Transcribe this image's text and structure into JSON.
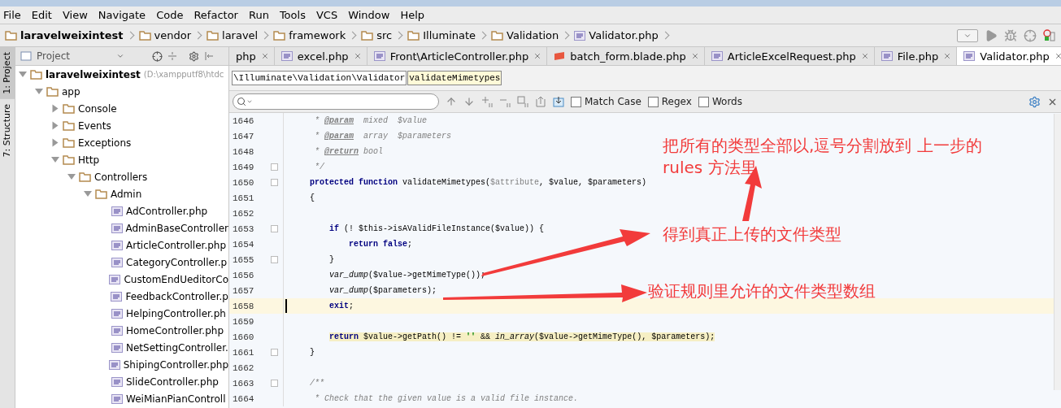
{
  "menu": [
    "File",
    "Edit",
    "View",
    "Navigate",
    "Code",
    "Refactor",
    "Run",
    "Tools",
    "VCS",
    "Window",
    "Help"
  ],
  "breadcrumb": [
    {
      "label": "laravelweixintest",
      "kind": "root"
    },
    {
      "label": "vendor",
      "kind": "folder"
    },
    {
      "label": "laravel",
      "kind": "folder"
    },
    {
      "label": "framework",
      "kind": "folder"
    },
    {
      "label": "src",
      "kind": "folder"
    },
    {
      "label": "Illuminate",
      "kind": "folder"
    },
    {
      "label": "Validation",
      "kind": "folder"
    },
    {
      "label": "Validator.php",
      "kind": "php"
    }
  ],
  "side_tabs": [
    {
      "label": "1: Project",
      "selected": true
    },
    {
      "label": "7: Structure",
      "selected": false
    }
  ],
  "project_panel": {
    "title": "Project",
    "tree": {
      "label": "laravelweixintest",
      "path": "(D:\\xampputf8\\htdc",
      "expanded": true,
      "children": [
        {
          "label": "app",
          "expanded": true,
          "children": [
            {
              "label": "Console",
              "expanded": false
            },
            {
              "label": "Events",
              "expanded": false
            },
            {
              "label": "Exceptions",
              "expanded": false
            },
            {
              "label": "Http",
              "expanded": true,
              "children": [
                {
                  "label": "Controllers",
                  "expanded": true,
                  "children": [
                    {
                      "label": "Admin",
                      "expanded": true,
                      "children": [
                        {
                          "label": "AdController.php",
                          "kind": "php"
                        },
                        {
                          "label": "AdminBaseController",
                          "kind": "php"
                        },
                        {
                          "label": "ArticleController.php",
                          "kind": "php"
                        },
                        {
                          "label": "CategoryController.p",
                          "kind": "php"
                        },
                        {
                          "label": "CustomEndUeditorCo",
                          "kind": "php"
                        },
                        {
                          "label": "FeedbackController.p",
                          "kind": "php"
                        },
                        {
                          "label": "HelpingController.ph",
                          "kind": "php"
                        },
                        {
                          "label": "HomeController.php",
                          "kind": "php"
                        },
                        {
                          "label": "NetSettingController.",
                          "kind": "php"
                        },
                        {
                          "label": "ShipingController.php",
                          "kind": "php"
                        },
                        {
                          "label": "SlideController.php",
                          "kind": "php"
                        },
                        {
                          "label": "WeiMianPianControll",
                          "kind": "php"
                        }
                      ]
                    }
                  ]
                }
              ]
            }
          ]
        }
      ]
    }
  },
  "tabs": [
    {
      "label": "php",
      "selected": false
    },
    {
      "label": "excel.php",
      "kind": "php",
      "selected": false
    },
    {
      "label": "Front\\ArticleController.php",
      "kind": "php",
      "selected": false
    },
    {
      "label": "batch_form.blade.php",
      "kind": "blade",
      "selected": false
    },
    {
      "label": "ArticleExcelRequest.php",
      "kind": "php",
      "selected": false
    },
    {
      "label": "File.php",
      "kind": "php",
      "selected": false
    },
    {
      "label": "Validator.php",
      "kind": "php",
      "selected": true
    }
  ],
  "editor_path": [
    {
      "label": "\\Illuminate\\Validation\\Validator",
      "selected": false
    },
    {
      "label": "validateMimetypes",
      "selected": true
    }
  ],
  "find_bar": {
    "options": [
      {
        "label": "Match Case",
        "checked": false
      },
      {
        "label": "Regex",
        "checked": false
      },
      {
        "label": "Words",
        "checked": false
      }
    ]
  },
  "code": [
    {
      "number": "1646",
      "fold": false,
      "current": false,
      "tokens": [
        {
          "kind": "comment",
          "text": "     * "
        },
        {
          "kind": "doctag",
          "text": "@param"
        },
        {
          "kind": "comment",
          "text": "  mixed  $value"
        }
      ]
    },
    {
      "number": "1647",
      "fold": false,
      "current": false,
      "tokens": [
        {
          "kind": "comment",
          "text": "     * "
        },
        {
          "kind": "doctag",
          "text": "@param"
        },
        {
          "kind": "comment",
          "text": "  array  $parameters"
        }
      ]
    },
    {
      "number": "1648",
      "fold": false,
      "current": false,
      "tokens": [
        {
          "kind": "comment",
          "text": "     * "
        },
        {
          "kind": "doctag",
          "text": "@return"
        },
        {
          "kind": "comment",
          "text": " bool"
        }
      ]
    },
    {
      "number": "1649",
      "fold": true,
      "current": false,
      "tokens": [
        {
          "kind": "comment",
          "text": "     */"
        }
      ]
    },
    {
      "number": "1650",
      "fold": true,
      "current": false,
      "tokens": [
        {
          "kind": "keyword",
          "text": "    protected function"
        },
        {
          "kind": "plain",
          "text": " validateMimetypes("
        },
        {
          "kind": "param",
          "text": "$attribute"
        },
        {
          "kind": "plain",
          "text": ", $value, $parameters)"
        }
      ]
    },
    {
      "number": "1651",
      "fold": false,
      "current": false,
      "tokens": [
        {
          "kind": "plain",
          "text": "    {"
        }
      ]
    },
    {
      "number": "1652",
      "fold": false,
      "current": false
    },
    {
      "number": "1653",
      "fold": true,
      "current": false,
      "tokens": [
        {
          "kind": "keyword",
          "text": "        if"
        },
        {
          "kind": "plain",
          "text": " (! $this->isAValidFileInstance($value)) {"
        }
      ]
    },
    {
      "number": "1654",
      "fold": false,
      "current": false,
      "tokens": [
        {
          "kind": "keyword",
          "text": "            return false"
        },
        {
          "kind": "plain",
          "text": ";"
        }
      ]
    },
    {
      "number": "1655",
      "fold": true,
      "current": false,
      "tokens": [
        {
          "kind": "plain",
          "text": "        }"
        }
      ]
    },
    {
      "number": "1656",
      "fold": false,
      "current": false,
      "tokens": [
        {
          "kind": "fn",
          "text": "        var_dump"
        },
        {
          "kind": "plain",
          "text": "($value->getMimeType());"
        }
      ]
    },
    {
      "number": "1657",
      "fold": false,
      "current": false,
      "tokens": [
        {
          "kind": "fn",
          "text": "        var_dump"
        },
        {
          "kind": "plain",
          "text": "($parameters);"
        }
      ]
    },
    {
      "number": "1658",
      "fold": false,
      "current": true,
      "tokens": [
        {
          "kind": "keyword",
          "text": "        exit"
        },
        {
          "kind": "plain",
          "text": ";"
        }
      ]
    },
    {
      "number": "1659",
      "fold": false,
      "current": false
    },
    {
      "number": "1660",
      "fold": false,
      "current": false,
      "marked": true,
      "tokens": [
        {
          "kind": "keyword",
          "text": "        return"
        },
        {
          "kind": "plain",
          "text": " $value->getPath() != "
        },
        {
          "kind": "string",
          "text": "''"
        },
        {
          "kind": "plain",
          "text": " && "
        },
        {
          "kind": "fn",
          "text": "in_array"
        },
        {
          "kind": "plain",
          "text": "($value->getMimeType(), $parameters);"
        }
      ]
    },
    {
      "number": "1661",
      "fold": true,
      "current": false,
      "tokens": [
        {
          "kind": "plain",
          "text": "    }"
        }
      ]
    },
    {
      "number": "1662",
      "fold": false,
      "current": false
    },
    {
      "number": "1663",
      "fold": true,
      "current": false,
      "tokens": [
        {
          "kind": "comment",
          "text": "    /**"
        }
      ]
    },
    {
      "number": "1664",
      "fold": false,
      "current": false,
      "tokens": [
        {
          "kind": "comment",
          "text": "     * Check that the given value is a valid file instance."
        }
      ]
    }
  ],
  "annotations": [
    {
      "lines": [
        "把所有的类型全部以,逗号分割放到 上一步的",
        "rules 方法里"
      ]
    },
    {
      "lines": [
        "得到真正上传的文件类型"
      ]
    },
    {
      "lines": [
        "验证规则里允许的文件类型数组"
      ]
    }
  ]
}
